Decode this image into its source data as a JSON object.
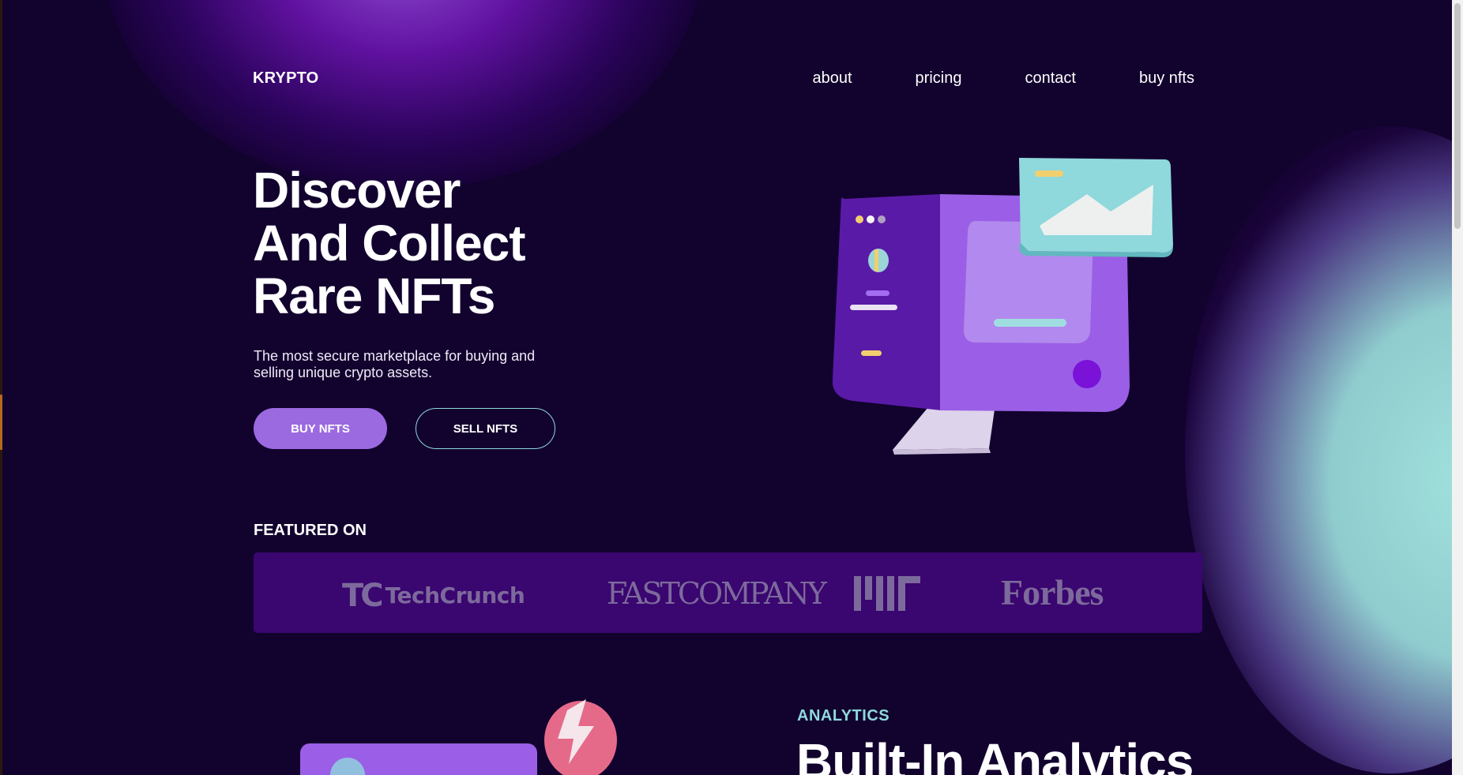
{
  "nav": {
    "logo": "KRYPTO",
    "links": [
      "about",
      "pricing",
      "contact",
      "buy nfts"
    ]
  },
  "hero": {
    "title_line1": "Discover",
    "title_line2": "And Collect",
    "title_line3": "Rare NFTs",
    "subtitle": "The most secure marketplace for buying and selling unique crypto assets.",
    "buy_button": "BUY NFTS",
    "sell_button": "SELL NFTS"
  },
  "featured": {
    "label": "FEATURED ON",
    "brands": [
      "TechCrunch",
      "FAST COMPANY",
      "MIT",
      "Forbes"
    ],
    "techcrunch_text": "TechCrunch",
    "fastcompany_text": "FASTCOMPANY",
    "forbes_text": "Forbes"
  },
  "analytics": {
    "tag": "ANALYTICS",
    "title": "Built-In Analytics"
  },
  "colors": {
    "background": "#12022e",
    "accent_purple": "#9b6ae0",
    "accent_teal": "#8fd8dc",
    "logos_bar": "#3a0670"
  }
}
